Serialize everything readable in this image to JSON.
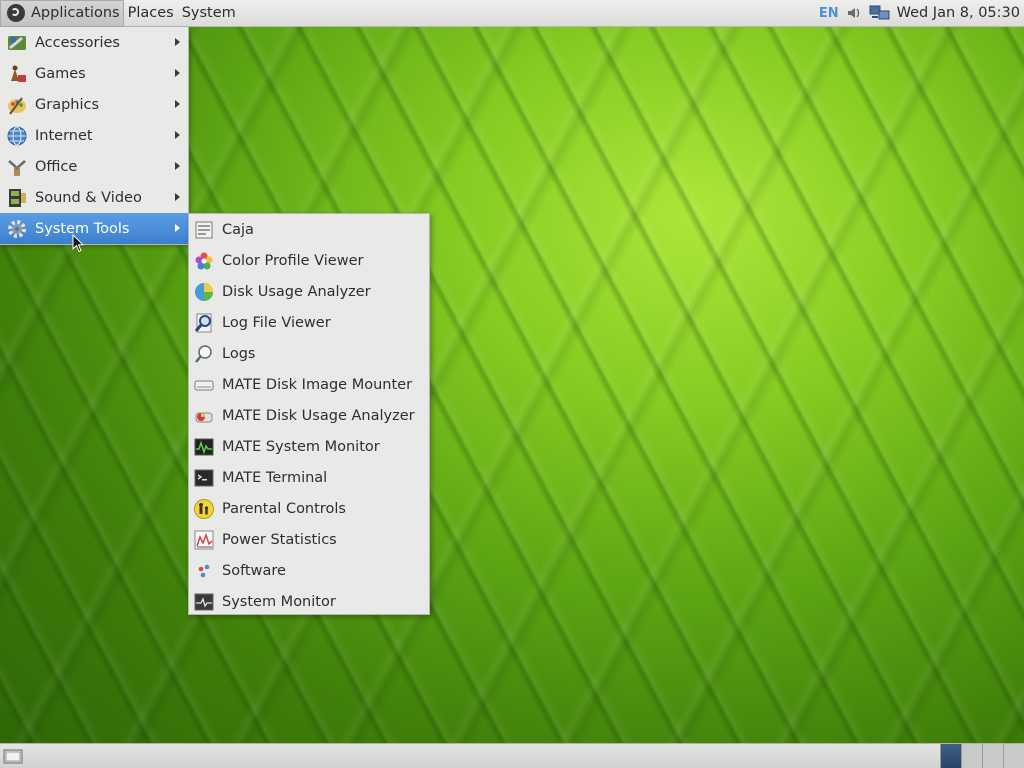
{
  "top_panel": {
    "menus": [
      "Applications",
      "Places",
      "System"
    ],
    "keyboard_layout": "EN",
    "clock": "Wed Jan  8, 05:30"
  },
  "apps_menu": {
    "items": [
      {
        "label": "Accessories",
        "icon": "accessories-icon"
      },
      {
        "label": "Games",
        "icon": "games-icon"
      },
      {
        "label": "Graphics",
        "icon": "graphics-icon"
      },
      {
        "label": "Internet",
        "icon": "internet-icon"
      },
      {
        "label": "Office",
        "icon": "office-icon"
      },
      {
        "label": "Sound & Video",
        "icon": "sound-video-icon"
      },
      {
        "label": "System Tools",
        "icon": "system-tools-icon",
        "highlighted": true
      }
    ]
  },
  "system_tools_menu": {
    "items": [
      {
        "label": "Caja",
        "icon": "file-manager-icon"
      },
      {
        "label": "Color Profile Viewer",
        "icon": "color-profile-icon"
      },
      {
        "label": "Disk Usage Analyzer",
        "icon": "disk-usage-pie-icon"
      },
      {
        "label": "Log File Viewer",
        "icon": "log-viewer-icon"
      },
      {
        "label": "Logs",
        "icon": "logs-magnifier-icon"
      },
      {
        "label": "MATE Disk Image Mounter",
        "icon": "disk-image-icon"
      },
      {
        "label": "MATE Disk Usage Analyzer",
        "icon": "mate-disk-usage-icon"
      },
      {
        "label": "MATE System Monitor",
        "icon": "system-monitor-icon"
      },
      {
        "label": "MATE Terminal",
        "icon": "terminal-icon"
      },
      {
        "label": "Parental Controls",
        "icon": "parental-controls-icon"
      },
      {
        "label": "Power Statistics",
        "icon": "power-statistics-icon"
      },
      {
        "label": "Software",
        "icon": "software-icon"
      },
      {
        "label": "System Monitor",
        "icon": "system-monitor-2-icon"
      }
    ]
  },
  "colors": {
    "highlight": "#4a8ed9",
    "menu_bg": "#e9e9e8",
    "panel_bg": "#e2e2e0",
    "wallpaper": "#6bb81a"
  }
}
